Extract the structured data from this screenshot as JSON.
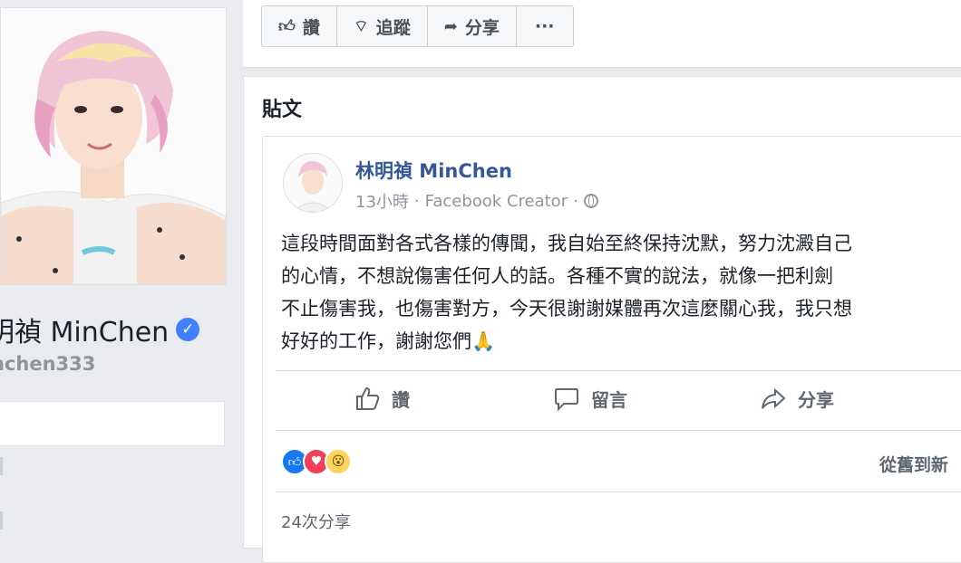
{
  "page": {
    "name": "明禎 MinChen",
    "handle": "nchen333"
  },
  "action_bar": {
    "like_label": "讚",
    "follow_label": "追蹤",
    "share_label": "分享",
    "more_label": "···"
  },
  "posts": {
    "section_title": "貼文",
    "post": {
      "author": "林明禎 MinChen",
      "time": "13小時",
      "separator": "·",
      "category": "Facebook Creator",
      "separator2": "·",
      "body_lines": [
        "這段時間面對各式各樣的傳聞，我自始至終保持沈默，努力沈澱自己",
        "的心情，不想說傷害任何人的話。各種不實的說法，就像一把利劍",
        "不止傷害我，也傷害對方，今天很謝謝媒體再次這麼關心我，我只想",
        "好好的工作，謝謝您們🙏"
      ],
      "actions": {
        "like": "讚",
        "comment": "留言",
        "share": "分享"
      },
      "sort_label": "從舊到新",
      "share_count": "24次分享"
    }
  },
  "colors": {
    "link": "#365899",
    "like_blue": "#1877f2",
    "love_red": "#f33e58",
    "wow_yellow": "#fcd35d"
  }
}
